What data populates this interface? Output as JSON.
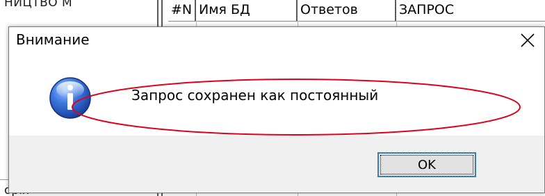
{
  "background": {
    "left_panel_top_text": "НИЦТВО М",
    "left_panel_bottom_text": "орія",
    "table_columns": [
      {
        "label": "#N"
      },
      {
        "label": "Имя БД"
      },
      {
        "label": "Ответов"
      },
      {
        "label": "ЗАПРОС"
      }
    ]
  },
  "dialog": {
    "title": "Внимание",
    "message": "Запрос сохранен как постоянный",
    "ok_label": "OK",
    "close_glyph": "✕",
    "icon": "info-icon",
    "annotation": "red-ellipse-highlight"
  },
  "colors": {
    "icon_blue": "#2a5fc2",
    "highlight_red": "#e0001a",
    "button_focus_border": "#3c7fb1",
    "footer_gray": "#f0f0f0"
  }
}
